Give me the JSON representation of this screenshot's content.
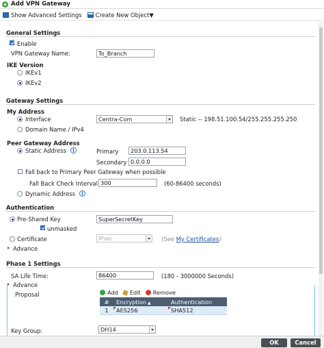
{
  "window": {
    "title": "Add VPN Gateway"
  },
  "toolbar": {
    "show_advanced": "Show Advanced Settings",
    "create_new": "Create New Object▼"
  },
  "general": {
    "section": "General Settings",
    "enable_label": "Enable",
    "enable_checked": true,
    "gateway_name_label": "VPN Gateway Name:",
    "gateway_name_value": "To_Branch",
    "ike_heading": "IKE Version",
    "ikev1": "IKEv1",
    "ikev2": "IKEv2",
    "ike_selected": "IKEv2"
  },
  "gateway": {
    "section": "Gateway Settings",
    "my_address_heading": "My Address",
    "interface_label": "Interface",
    "interface_value": "Centra-Com",
    "interface_static": "Static -- 198.51.100.54/255.255.255.250",
    "domain_label": "Domain Name / IPv4",
    "peer_heading": "Peer Gateway Address",
    "static_label": "Static Address",
    "primary_label": "Primary",
    "primary_value": "203.0.113.54",
    "secondary_label": "Secondary",
    "secondary_value": "0.0.0.0",
    "fallback_label": "Fall back to Primary Peer Gateway when possible",
    "fallback_interval_label": "Fall Back Check Interval:",
    "fallback_interval_value": "300",
    "fallback_interval_range": "(60-86400 seconds)",
    "dynamic_label": "Dynamic Address"
  },
  "auth": {
    "section": "Authentication",
    "psk_label": "Pre-Shared Key",
    "psk_value": "SuperSecretKey",
    "unmasked_label": "unmasked",
    "cert_label": "Certificate",
    "cert_value": "IPsec",
    "see_text": "(See ",
    "my_certs_link": "My Certificates",
    "see_close": ")",
    "advance_label": "Advance"
  },
  "phase1": {
    "section": "Phase 1 Settings",
    "sa_label": "SA Life Time:",
    "sa_value": "86400",
    "sa_range": "(180 - 3000000 Seconds)",
    "advance_label": "Advance",
    "proposal_label": "Proposal",
    "grid_tools": {
      "add": "Add",
      "edit": "Edit",
      "remove": "Remove"
    },
    "grid_columns": {
      "num": "#",
      "encryption": "Encryption",
      "sort_indicator": "▲",
      "authentication": "Authentication"
    },
    "grid_rows": [
      {
        "num": "1",
        "encryption": "AES256",
        "authentication": "SHA512"
      }
    ],
    "key_group_label": "Key Group:",
    "key_group_value": "DH14"
  },
  "footer": {
    "ok": "OK",
    "cancel": "Cancel"
  },
  "colors": {
    "accent": "#3c77c9",
    "header_grid": "#4c5e71",
    "selected_row": "#ddeaf7",
    "advance_border": "#6ec7e8"
  }
}
